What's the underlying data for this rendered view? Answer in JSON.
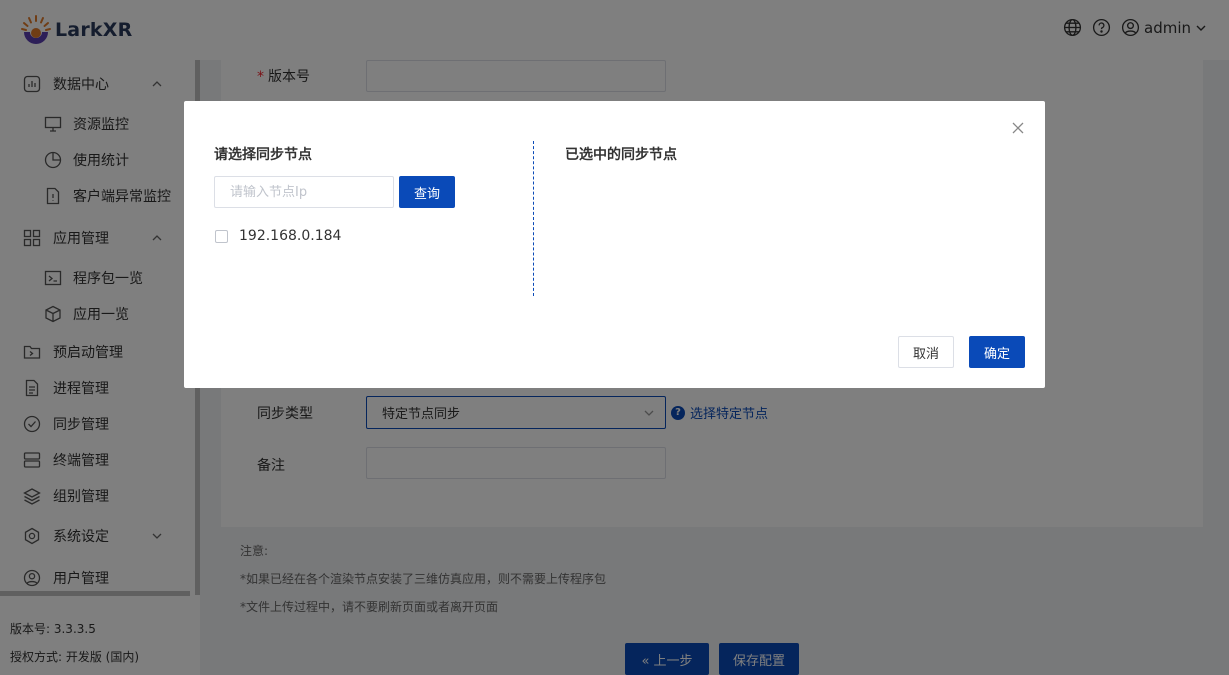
{
  "app": {
    "name": "LarkXR"
  },
  "header": {
    "language_icon": "globe-icon",
    "help_icon": "question-circle-icon",
    "user_icon": "user-circle-icon",
    "user_name": "admin"
  },
  "sidebar": {
    "items": [
      {
        "label": "数据中心",
        "icon": "chart-bar-icon"
      },
      {
        "label": "资源监控",
        "icon": "monitor-icon"
      },
      {
        "label": "使用统计",
        "icon": "pie-chart-icon"
      },
      {
        "label": "客户端异常监控",
        "icon": "file-alert-icon"
      },
      {
        "label": "应用管理",
        "icon": "grid-icon"
      },
      {
        "label": "程序包一览",
        "icon": "terminal-icon"
      },
      {
        "label": "应用一览",
        "icon": "cube-icon"
      },
      {
        "label": "预启动管理",
        "icon": "folder-icon"
      },
      {
        "label": "进程管理",
        "icon": "document-icon"
      },
      {
        "label": "同步管理",
        "icon": "check-circle-icon"
      },
      {
        "label": "终端管理",
        "icon": "server-icon"
      },
      {
        "label": "组别管理",
        "icon": "layers-icon"
      },
      {
        "label": "系统设定",
        "icon": "settings-icon"
      },
      {
        "label": "用户管理",
        "icon": "user-circle-icon"
      }
    ],
    "version_text": "版本号: 3.3.3.5",
    "license_text": "授权方式: 开发版 (国内)"
  },
  "form": {
    "version_label": "版本号",
    "version_value": "",
    "sync_type_label": "同步类型",
    "sync_type_value": "特定节点同步",
    "select_nodes_link": "选择特定节点",
    "remark_label": "备注",
    "remark_value": ""
  },
  "notes": {
    "title": "注意:",
    "line1": "*如果已经在各个渲染节点安装了三维仿真应用，则不需要上传程序包",
    "line2": "*文件上传过程中，请不要刷新页面或者离开页面"
  },
  "footer_buttons": {
    "prev_label": "« 上一步",
    "save_label": "保存配置"
  },
  "dialog": {
    "left_title": "请选择同步节点",
    "search_placeholder": "请输入节点Ip",
    "search_value": "",
    "query_label": "查询",
    "nodes": [
      {
        "ip": "192.168.0.184",
        "checked": false
      }
    ],
    "right_title": "已选中的同步节点",
    "cancel_label": "取消",
    "ok_label": "确定"
  },
  "colors": {
    "primary": "#0a4ab8",
    "required": "#f5222d",
    "overlay": "rgba(0,0,0,0.5)"
  }
}
